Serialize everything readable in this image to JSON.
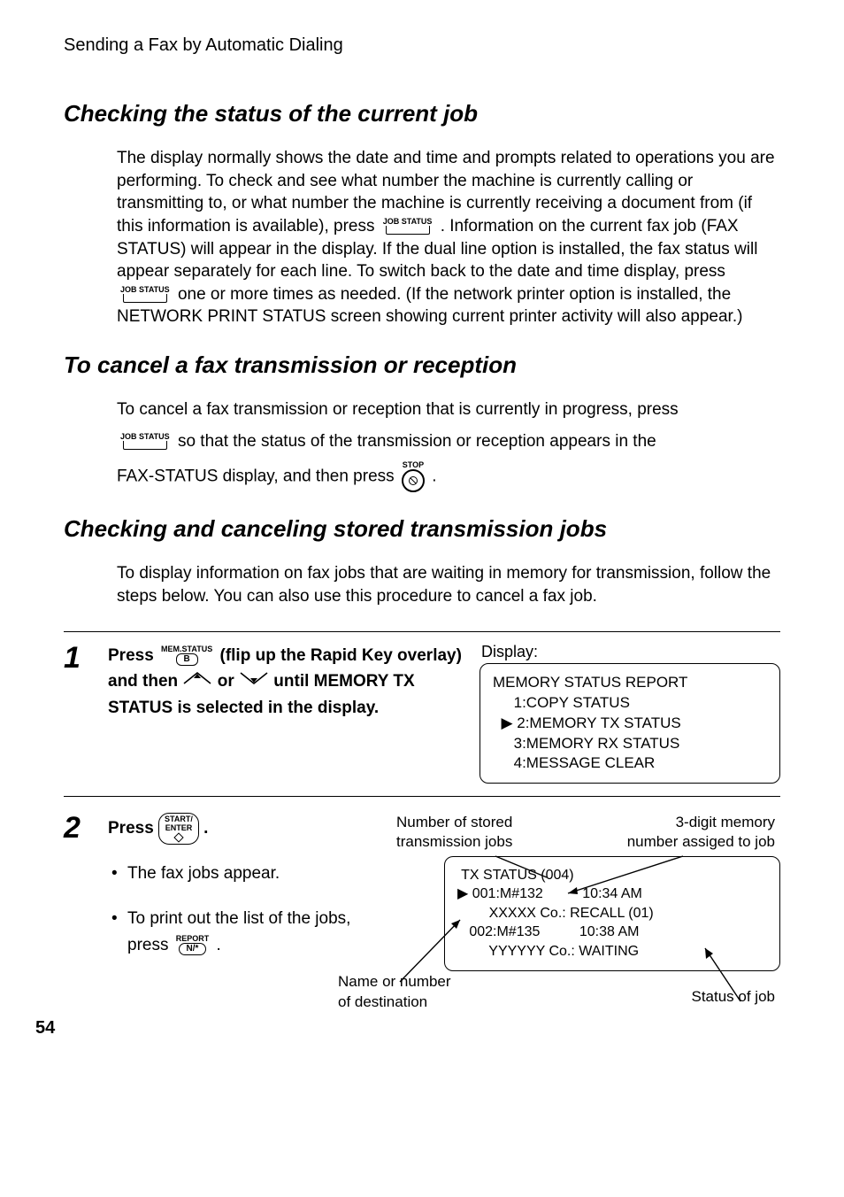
{
  "running_head": "Sending a Fax by Automatic Dialing",
  "page_number": "54",
  "keys": {
    "job_status": "JOB STATUS",
    "stop": "STOP",
    "mem_status_top": "MEM.STATUS",
    "mem_status_btn": "B",
    "start_top": "START/",
    "start_bottom": "ENTER",
    "report_top": "REPORT",
    "report_btn": "N/*"
  },
  "sec1": {
    "title": "Checking the status of the current job",
    "p1a": "The display normally shows the date and time and prompts related to operations you are performing. To check and see what number the machine is currently calling or transmitting to, or what number the machine is currently receiving a",
    "p1b_pre": "document from (if this information is available), press ",
    "p1b_post": " . Information on the current fax job (FAX STATUS) will appear in the display. If the dual line option is installed, the fax status will appear separately for each line. To switch back to the",
    "p1c_pre": "date and time display, press ",
    "p1c_post": " one or more times as needed. (If the network printer option is installed, the NETWORK PRINT STATUS screen showing current printer activity will also appear.)"
  },
  "sec2": {
    "title": "To cancel a fax transmission or reception",
    "p1": "To cancel a fax transmission or reception that is currently in progress, press",
    "p2_post": " so that the status of the transmission or reception appears in the",
    "p3_pre": "FAX-STATUS display, and then press ",
    "p3_post": " ."
  },
  "sec3": {
    "title": "Checking and canceling stored transmission jobs",
    "p1": "To display information on fax jobs that are waiting in memory for transmission, follow the steps below. You can also use this procedure to cancel a fax job."
  },
  "step1": {
    "num": "1",
    "instr_a": "Press ",
    "instr_b": " (flip up the Rapid Key overlay) and then ",
    "instr_c": " or ",
    "instr_d": " until MEMORY TX STATUS is selected in the display.",
    "display_label": "Display:",
    "panel": "MEMORY STATUS REPORT\n     1:COPY STATUS\n  ▶ 2:MEMORY TX STATUS\n     3:MEMORY RX STATUS\n     4:MESSAGE CLEAR"
  },
  "step2": {
    "num": "2",
    "instr": "Press ",
    "instr_end": ".",
    "b1": "The fax jobs appear.",
    "b2_pre": "To print out the list of the jobs, press ",
    "b2_post": " .",
    "ann_stored_a": "Number of stored",
    "ann_stored_b": "transmission jobs",
    "ann_memnum_a": "3-digit memory",
    "ann_memnum_b": "number assiged to job",
    "ann_dest_a": "Name or number",
    "ann_dest_b": "of destination",
    "ann_status": "Status of job",
    "panel": " TX STATUS (004)\n▶ 001:M#132          10:34 AM\n        XXXXX Co.: RECALL (01)\n   002:M#135          10:38 AM\n        YYYYYY Co.: WAITING"
  }
}
